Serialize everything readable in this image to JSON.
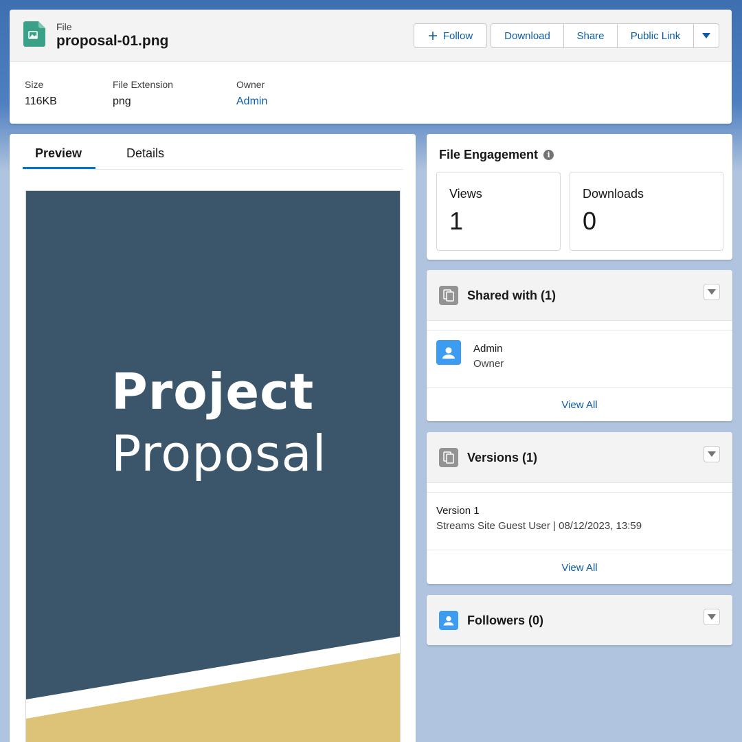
{
  "header": {
    "eyebrow": "File",
    "title": "proposal-01.png",
    "buttons": {
      "follow": "Follow",
      "download": "Download",
      "share": "Share",
      "public_link": "Public Link"
    },
    "fields": [
      {
        "label": "Size",
        "value": "116KB"
      },
      {
        "label": "File Extension",
        "value": "png"
      },
      {
        "label": "Owner",
        "value": "Admin"
      }
    ]
  },
  "preview": {
    "tabs": [
      {
        "label": "Preview",
        "active": true
      },
      {
        "label": "Details",
        "active": false
      }
    ],
    "document": {
      "title_line1": "Project",
      "title_line2": "Proposal",
      "colors": {
        "navy": "#3b556b",
        "gold": "#dcc378"
      }
    }
  },
  "engagement": {
    "title": "File Engagement",
    "views_label": "Views",
    "views": "1",
    "downloads_label": "Downloads",
    "downloads": "0"
  },
  "shared": {
    "title": "Shared with (1)",
    "user_name": "Admin",
    "user_role": "Owner",
    "view_all": "View All"
  },
  "versions": {
    "title": "Versions (1)",
    "version_name": "Version 1",
    "version_meta": "Streams Site Guest User | 08/12/2023, 13:59",
    "view_all": "View All"
  },
  "followers": {
    "title": "Followers (0)"
  },
  "icons": {
    "file": "image-file-icon",
    "plus": "plus-icon",
    "dropdown": "chevron-down-icon",
    "info": "info-icon",
    "files": "files-icon",
    "user": "user-icon"
  },
  "colors": {
    "brand_link": "#0b5cab",
    "accent": "#0176d3",
    "page_bg": "#b0c4df"
  }
}
